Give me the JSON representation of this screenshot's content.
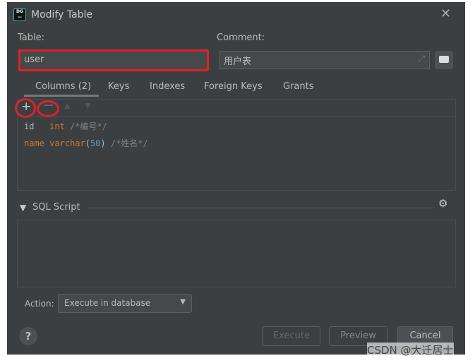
{
  "window": {
    "title": "Modify Table",
    "logo_text": "DG"
  },
  "table": {
    "label": "Table:",
    "value": "user"
  },
  "comment": {
    "label": "Comment:",
    "value": "用户表"
  },
  "tabs": [
    {
      "label": "Columns (2)",
      "active": true
    },
    {
      "label": "Keys"
    },
    {
      "label": "Indexes"
    },
    {
      "label": "Foreign Keys"
    },
    {
      "label": "Grants"
    }
  ],
  "columns": [
    {
      "name": "id",
      "type": "int",
      "size": "",
      "comment": "/*编号*/"
    },
    {
      "name": "name",
      "type": "varchar",
      "size": "50",
      "comment": "/*姓名*/"
    }
  ],
  "sql_script": {
    "label": "SQL Script",
    "content": ""
  },
  "action": {
    "label": "Action:",
    "value": "Execute in database"
  },
  "buttons": {
    "help": "?",
    "execute": "Execute",
    "preview": "Preview",
    "cancel": "Cancel"
  },
  "watermark": "CSDN @大迁居士",
  "colors": {
    "background": "#3c3f41",
    "highlight": "#e0202a",
    "keyword": "#cc7832",
    "number": "#6897bb"
  }
}
